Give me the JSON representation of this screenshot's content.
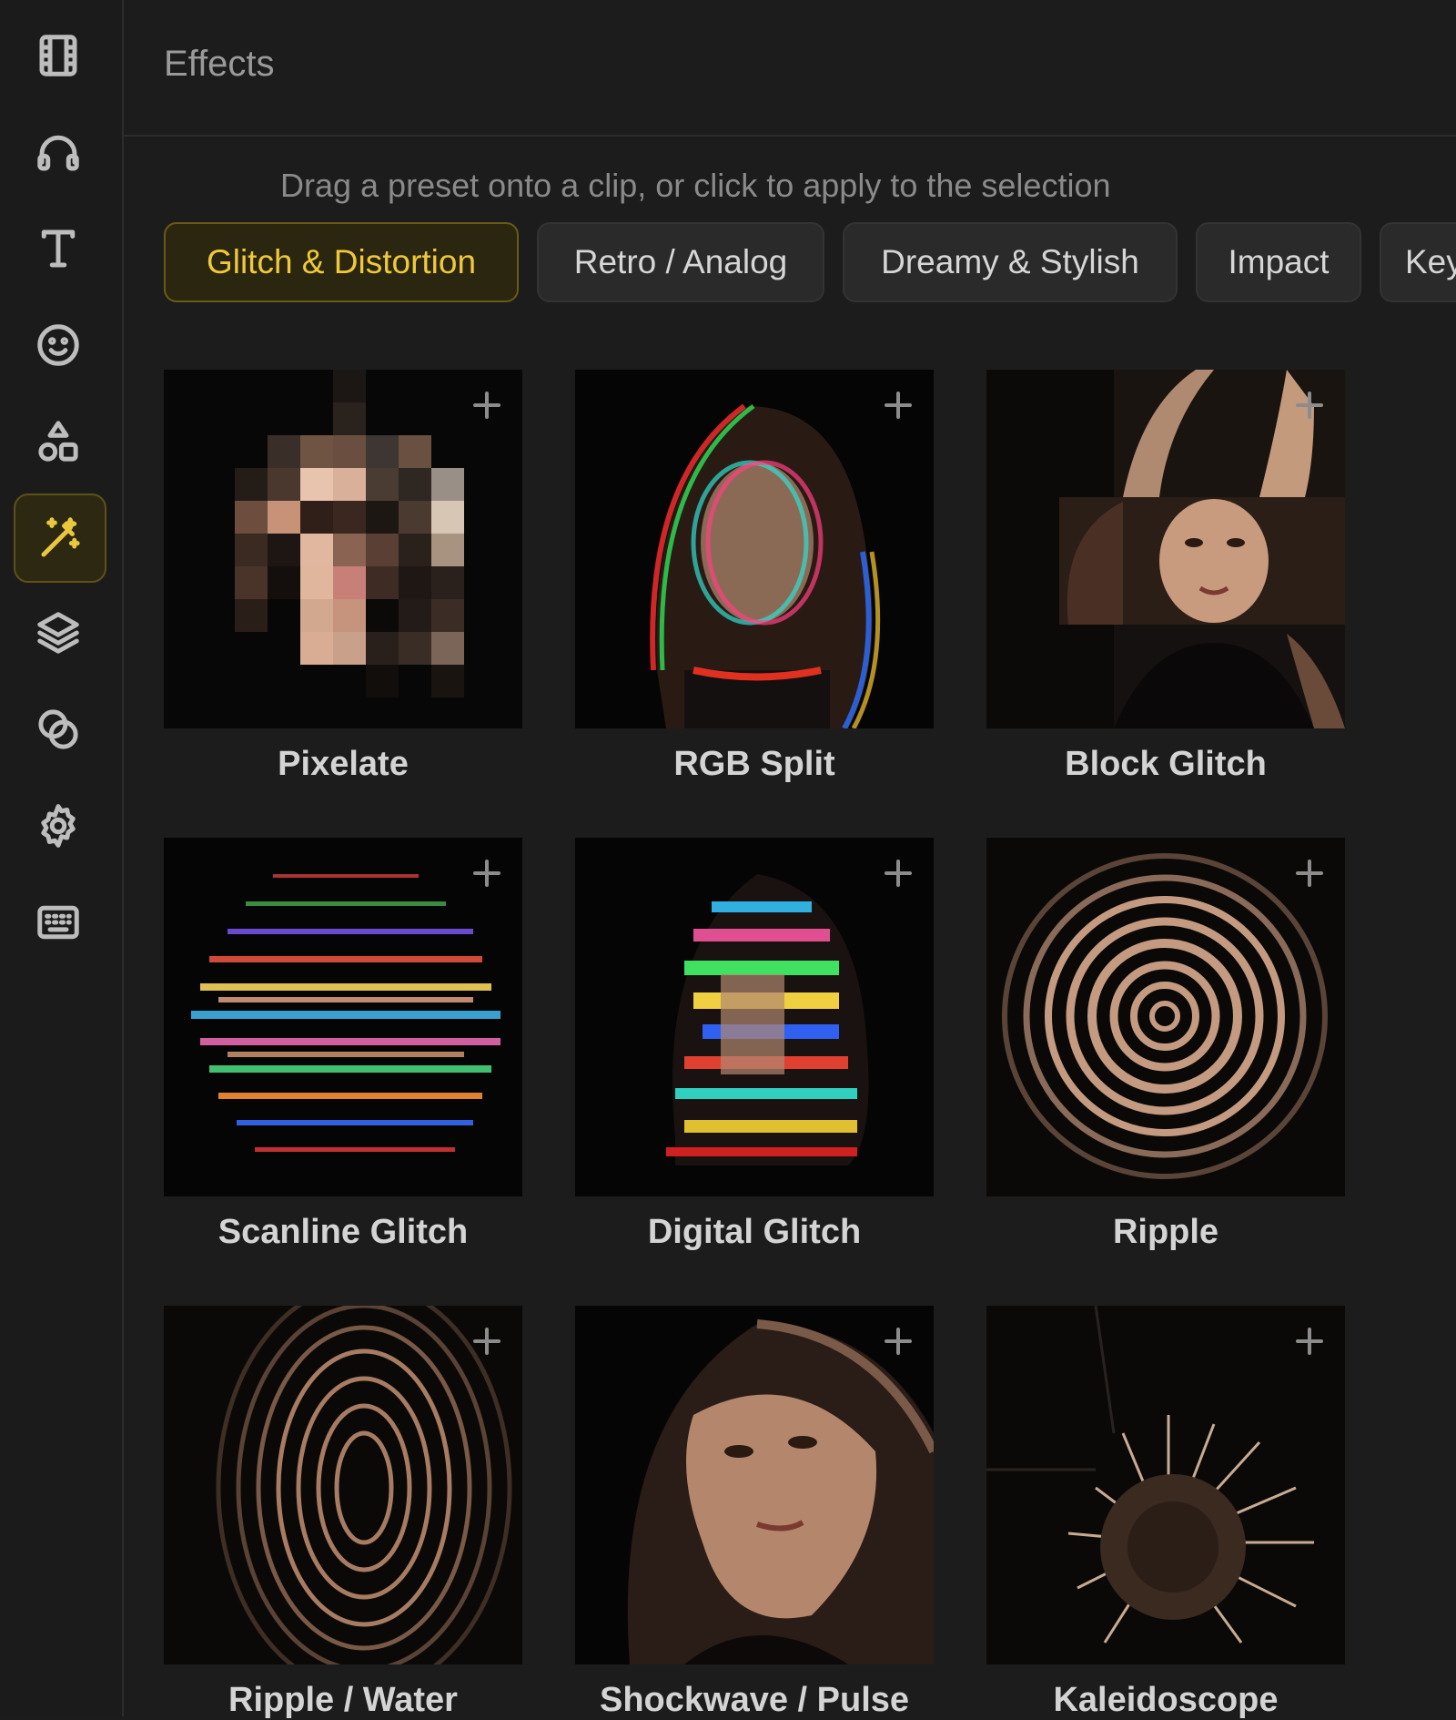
{
  "sidebar": {
    "items": [
      {
        "icon": "film-icon"
      },
      {
        "icon": "headphones-icon"
      },
      {
        "icon": "text-icon"
      },
      {
        "icon": "smiley-icon"
      },
      {
        "icon": "shapes-icon"
      },
      {
        "icon": "magic-wand-icon",
        "active": true
      },
      {
        "icon": "layers-icon"
      },
      {
        "icon": "blend-circles-icon"
      },
      {
        "icon": "gear-icon"
      },
      {
        "icon": "keyboard-icon"
      }
    ],
    "accent_color": "#e9c83e"
  },
  "header": {
    "title": "Effects"
  },
  "hint": "Drag a preset onto a clip, or click to apply to the selection",
  "tabs": [
    {
      "label": "Glitch & Distortion",
      "active": true
    },
    {
      "label": "Retro / Analog"
    },
    {
      "label": "Dreamy & Stylish"
    },
    {
      "label": "Impact"
    },
    {
      "label": "Key"
    }
  ],
  "presets": [
    {
      "name": "Pixelate"
    },
    {
      "name": "RGB Split"
    },
    {
      "name": "Block Glitch"
    },
    {
      "name": "Scanline Glitch"
    },
    {
      "name": "Digital Glitch"
    },
    {
      "name": "Ripple"
    },
    {
      "name": "Ripple / Water"
    },
    {
      "name": "Shockwave / Pulse"
    },
    {
      "name": "Kaleidoscope"
    }
  ]
}
